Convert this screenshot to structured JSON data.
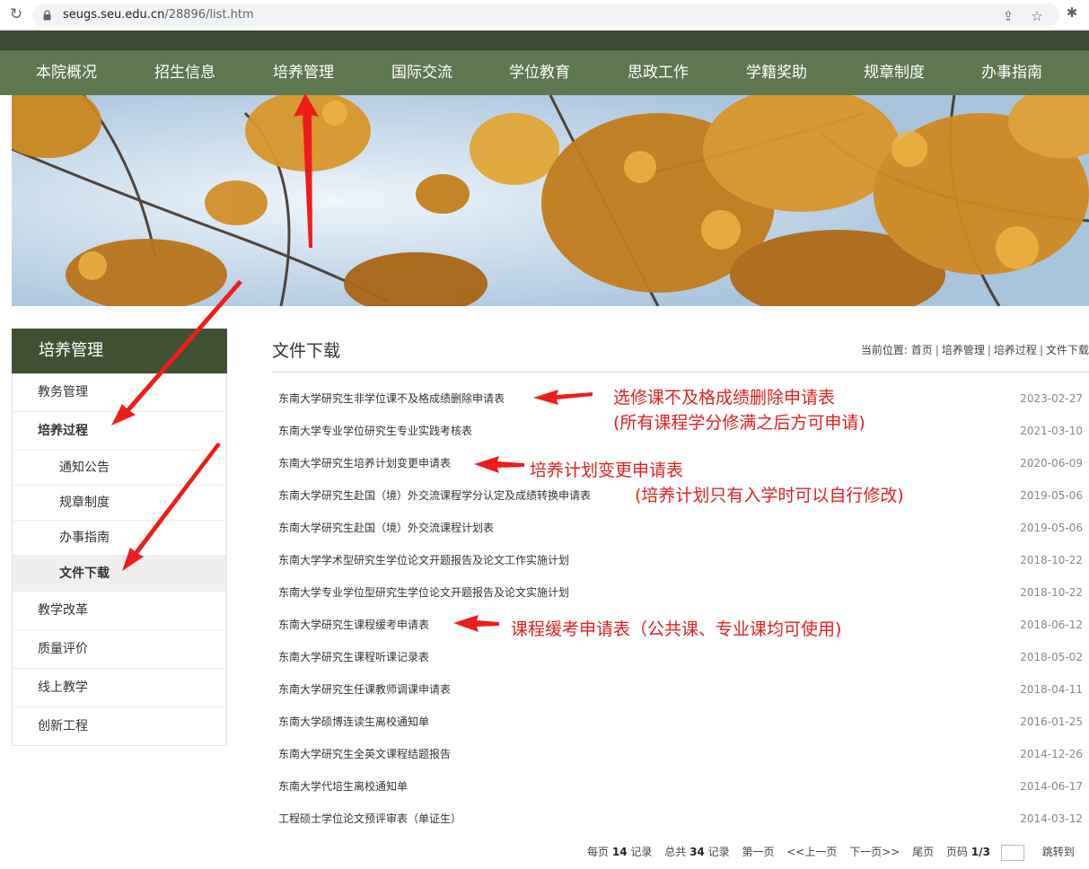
{
  "browser": {
    "url_host": "seugs.seu.edu.cn",
    "url_path": "/28896/list.htm"
  },
  "nav": [
    {
      "label": "本院概况"
    },
    {
      "label": "招生信息"
    },
    {
      "label": "培养管理"
    },
    {
      "label": "国际交流"
    },
    {
      "label": "学位教育"
    },
    {
      "label": "思政工作"
    },
    {
      "label": "学籍奖助"
    },
    {
      "label": "规章制度"
    },
    {
      "label": "办事指南"
    }
  ],
  "sidebar": {
    "title": "培养管理",
    "items": [
      {
        "label": "教务管理"
      },
      {
        "label": "培养过程"
      },
      {
        "label": "通知公告"
      },
      {
        "label": "规章制度"
      },
      {
        "label": "办事指南"
      },
      {
        "label": "文件下载"
      },
      {
        "label": "教学改革"
      },
      {
        "label": "质量评价"
      },
      {
        "label": "线上教学"
      },
      {
        "label": "创新工程"
      }
    ]
  },
  "main": {
    "title": "文件下载",
    "breadcrumb": {
      "prefix": "当前位置:",
      "items": [
        "首页",
        "培养管理",
        "培养过程",
        "文件下载"
      ]
    },
    "files": [
      {
        "name": "东南大学研究生非学位课不及格成绩删除申请表",
        "date": "2023-02-27"
      },
      {
        "name": "东南大学专业学位研究生专业实践考核表",
        "date": "2021-03-10"
      },
      {
        "name": "东南大学研究生培养计划变更申请表",
        "date": "2020-06-09"
      },
      {
        "name": "东南大学研究生赴国（境）外交流课程学分认定及成绩转换申请表",
        "date": "2019-05-06"
      },
      {
        "name": "东南大学研究生赴国（境）外交流课程计划表",
        "date": "2019-05-06"
      },
      {
        "name": "东南大学学术型研究生学位论文开题报告及论文工作实施计划",
        "date": "2018-10-22"
      },
      {
        "name": "东南大学专业学位型研究生学位论文开题报告及论文实施计划",
        "date": "2018-10-22"
      },
      {
        "name": "东南大学研究生课程缓考申请表",
        "date": "2018-06-12"
      },
      {
        "name": "东南大学研究生课程听课记录表",
        "date": "2018-05-02"
      },
      {
        "name": "东南大学研究生任课教师调课申请表",
        "date": "2018-04-11"
      },
      {
        "name": "东南大学硕博连读生离校通知单",
        "date": "2016-01-25"
      },
      {
        "name": "东南大学研究生全英文课程结题报告",
        "date": "2014-12-26"
      },
      {
        "name": "东南大学代培生离校通知单",
        "date": "2014-06-17"
      },
      {
        "name": "工程硕士学位论文预评审表（单证生）",
        "date": "2014-03-12"
      }
    ]
  },
  "pager": {
    "per_page_label": "每页",
    "per_page": "14",
    "records_label": "记录",
    "total_label": "总共",
    "total": "34",
    "first": "第一页",
    "prev": "<<上一页",
    "next": "下一页>>",
    "last": "尾页",
    "page_label": "页码",
    "page": "1/3",
    "jump": "跳转到"
  },
  "annotations": {
    "a1_line1": "选修课不及格成绩删除申请表",
    "a1_line2": "(所有课程学分修满之后方可申请)",
    "a2_line1": "培养计划变更申请表",
    "a2_line2": "(培养计划只有入学时可以自行修改)",
    "a3": "课程缓考申请表（公共课、专业课均可使用)"
  },
  "colors": {
    "nav_bg": "#5e7750",
    "top_strip": "#3b4a33",
    "sidebar_title_bg": "#3f5132",
    "annotation": "#e02020"
  }
}
